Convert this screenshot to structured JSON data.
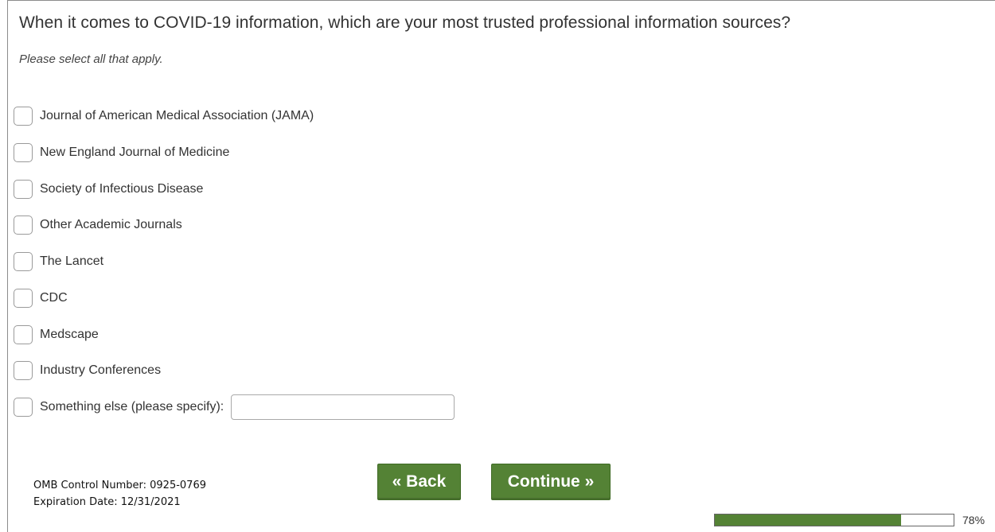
{
  "question": {
    "title": "When it comes to COVID-19 information, which are your most trusted professional information sources?",
    "instruction": "Please select all that apply."
  },
  "options": [
    {
      "label": "Journal of American Medical Association (JAMA)",
      "checked": false
    },
    {
      "label": "New England Journal of Medicine",
      "checked": false
    },
    {
      "label": "Society of Infectious Disease",
      "checked": false
    },
    {
      "label": "Other Academic Journals",
      "checked": false
    },
    {
      "label": "The Lancet",
      "checked": false
    },
    {
      "label": "CDC",
      "checked": false
    },
    {
      "label": "Medscape",
      "checked": false
    },
    {
      "label": "Industry Conferences",
      "checked": false
    },
    {
      "label": "Something else (please specify):",
      "checked": false
    }
  ],
  "other_input": {
    "value": "",
    "placeholder": ""
  },
  "nav": {
    "back_label": "« Back",
    "continue_label": "Continue »"
  },
  "footer": {
    "omb_control": "OMB Control Number: 0925-0769",
    "expiration": "Expiration Date: 12/31/2021"
  },
  "progress": {
    "percent": 78,
    "label": "78%"
  },
  "colors": {
    "accent": "#548235"
  }
}
